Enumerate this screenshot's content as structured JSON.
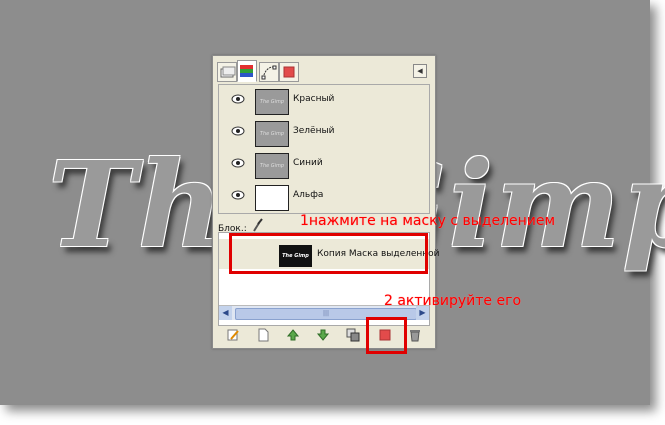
{
  "canvas": {
    "background_text": "The Gimp"
  },
  "dialog": {
    "tabs": [
      {
        "icon": "layers-tab-icon"
      },
      {
        "icon": "channels-tab-icon",
        "active": true
      },
      {
        "icon": "paths-tab-icon"
      },
      {
        "icon": "color-tab-icon"
      }
    ],
    "tab_menu_icon": "tab-menu-arrow-icon",
    "channels": [
      {
        "label": "Красный",
        "thumb_text": "The Gimp"
      },
      {
        "label": "Зелёный",
        "thumb_text": "The Gimp"
      },
      {
        "label": "Синий",
        "thumb_text": "The Gimp"
      },
      {
        "label": "Альфа",
        "thumb_text": ""
      }
    ],
    "lock_label": "Блок.:",
    "mask_channel": {
      "label": "Копия Маска выделенной",
      "thumb_text": "The Gimp"
    },
    "scrollbar_grip": "|||",
    "bottom_buttons": [
      "edit",
      "new",
      "raise",
      "lower",
      "duplicate",
      "to-selection",
      "delete"
    ]
  },
  "annotations": {
    "step1": "1нажмите на маску с выделением",
    "step2": "2 активируйте его"
  },
  "colors": {
    "annotation": "#ff0000",
    "dialog_bg": "#ece9d8",
    "canvas_bg": "#8d8d8d"
  }
}
